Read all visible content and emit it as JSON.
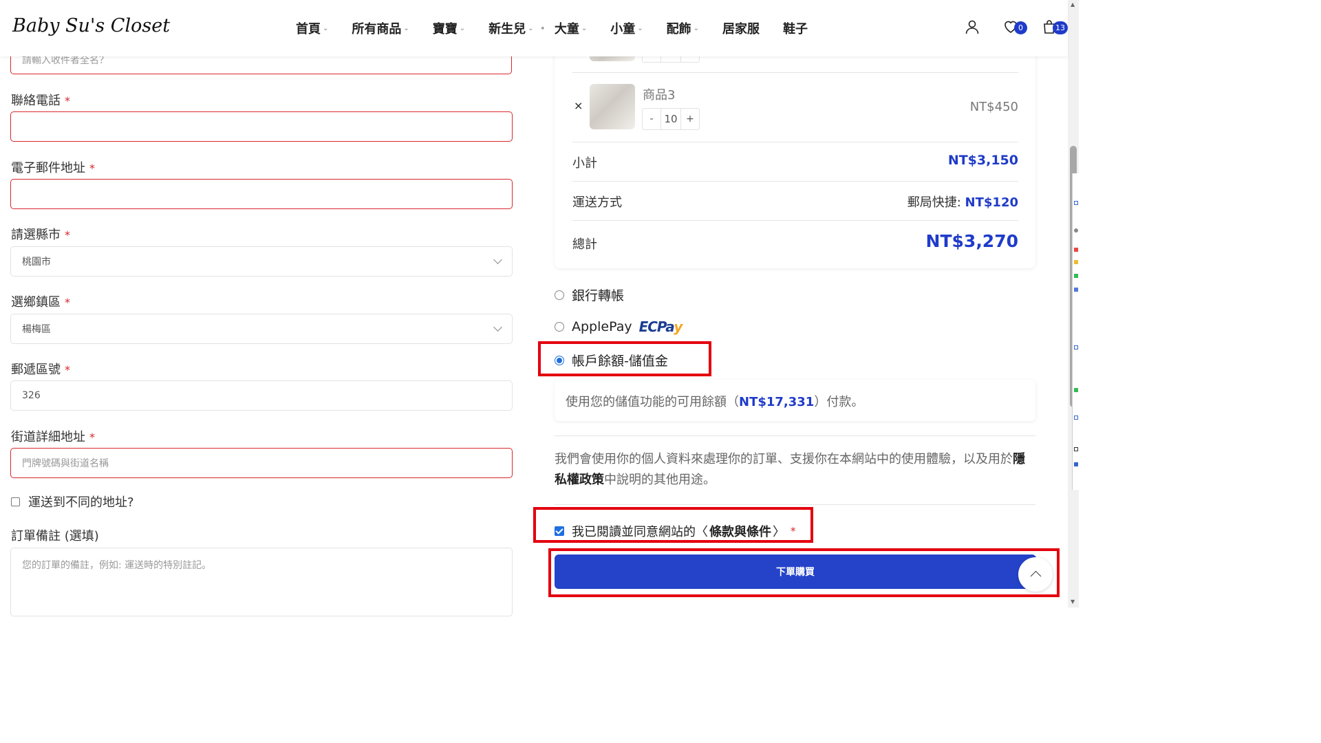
{
  "header": {
    "logo": "Baby Su's Closet",
    "nav": [
      {
        "label": "首頁",
        "chevron": true
      },
      {
        "label": "所有商品",
        "chevron": true
      },
      {
        "label": "寶寶",
        "chevron": true
      },
      {
        "label": "新生兒",
        "chevron": true
      },
      {
        "label": "大童",
        "chevron": true
      },
      {
        "label": "小童",
        "chevron": true
      },
      {
        "label": "配飾",
        "chevron": true
      },
      {
        "label": "居家服",
        "chevron": false
      },
      {
        "label": "鞋子",
        "chevron": false
      }
    ],
    "nav_dot": "∘",
    "wishlist_count": "0",
    "cart_count": "13"
  },
  "form": {
    "name_placeholder": "請輸入收件者全名？",
    "phone_label": "聯絡電話",
    "email_label": "電子郵件地址",
    "city_label": "請選縣市",
    "city_value": "桃園市",
    "district_label": "選鄉鎮區",
    "district_value": "楊梅區",
    "zip_label": "郵遞區號",
    "zip_value": "326",
    "street_label": "街道詳細地址",
    "street_placeholder": "門牌號碼與街道名稱",
    "ship_different_label": "運送到不同的地址?",
    "notes_label": "訂單備註 (選填)",
    "notes_placeholder": "您的訂單的備註，例如: 運送時的特別註記。",
    "required_mark": "*"
  },
  "order": {
    "product3_name": "商品3",
    "product3_qty": "10",
    "product3_price": "NT$450",
    "remove_symbol": "×",
    "qty_minus": "-",
    "qty_plus": "+",
    "subtotal_label": "小計",
    "subtotal_value": "NT$3,150",
    "shipping_label": "運送方式",
    "shipping_method": "郵局快捷: ",
    "shipping_value": "NT$120",
    "total_label": "總計",
    "total_value": "NT$3,270"
  },
  "payment": {
    "bank_transfer": "銀行轉帳",
    "applepay": "ApplePay",
    "ecpay_logo_ec": "EC",
    "ecpay_logo_pay": "Pa",
    "ecpay_logo_y": "y",
    "wallet": "帳戶餘額-儲值金",
    "wallet_desc_prefix": "使用您的儲值功能的可用餘額（",
    "wallet_balance": "NT$17,331",
    "wallet_desc_suffix": "）付款。",
    "privacy_text_1": "我們會使用你的個人資料來處理你的訂單、支援你在本網站中的使用體驗，以及用於",
    "privacy_link": "隱私權政策",
    "privacy_text_2": "中說明的其他用途。",
    "terms_prefix": "我已閱讀並同意網站的〈",
    "terms_link": "條款與條件",
    "terms_suffix": "〉",
    "place_order": "下單購買"
  },
  "colors": {
    "accent": "#2443c9",
    "error": "#d9252b",
    "highlight": "#e3000f"
  }
}
